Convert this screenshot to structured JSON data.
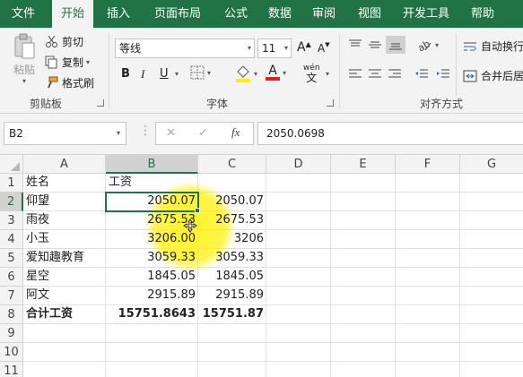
{
  "ribbon_tabs": [
    "文件",
    "开始",
    "插入",
    "页面布局",
    "公式",
    "数据",
    "审阅",
    "视图",
    "开发工具",
    "帮助"
  ],
  "active_tab": "开始",
  "clipboard": {
    "paste_label": "粘贴",
    "cut_label": "剪切",
    "copy_label": "复制",
    "format_painter_label": "格式刷",
    "group_label": "剪贴板"
  },
  "font": {
    "name": "等线",
    "size": "11",
    "bold": "B",
    "italic": "I",
    "underline": "U",
    "grow": "A",
    "shrink": "A",
    "wen_top": "wén",
    "wen_bottom": "文",
    "group_label": "字体"
  },
  "alignment": {
    "wrap_label": "自动换行",
    "merge_label": "合并后居",
    "group_label": "对齐方式"
  },
  "formula_bar": {
    "name_box": "B2",
    "cancel": "✕",
    "enter": "✓",
    "fx": "fx",
    "formula": "2050.0698"
  },
  "grid": {
    "columns": [
      "A",
      "B",
      "C",
      "D",
      "E",
      "F",
      "G"
    ],
    "rows": [
      "1",
      "2",
      "3",
      "4",
      "5",
      "6",
      "7",
      "8",
      "9",
      "10",
      "11"
    ],
    "selected_cell": "B2",
    "cells": [
      [
        "姓名",
        "工资",
        ""
      ],
      [
        "仰望",
        "2050.07",
        "2050.07"
      ],
      [
        "雨夜",
        "2675.53",
        "2675.53"
      ],
      [
        "小玉",
        "3206.00",
        "3206"
      ],
      [
        "爱知趣教育",
        "3059.33",
        "3059.33"
      ],
      [
        "星空",
        "1845.05",
        "1845.05"
      ],
      [
        "阿文",
        "2915.89",
        "2915.89"
      ],
      [
        "合计工资",
        "15751.8643",
        "15751.87"
      ]
    ]
  },
  "colors": {
    "accent": "#217346",
    "highlight": "#ffef00"
  }
}
